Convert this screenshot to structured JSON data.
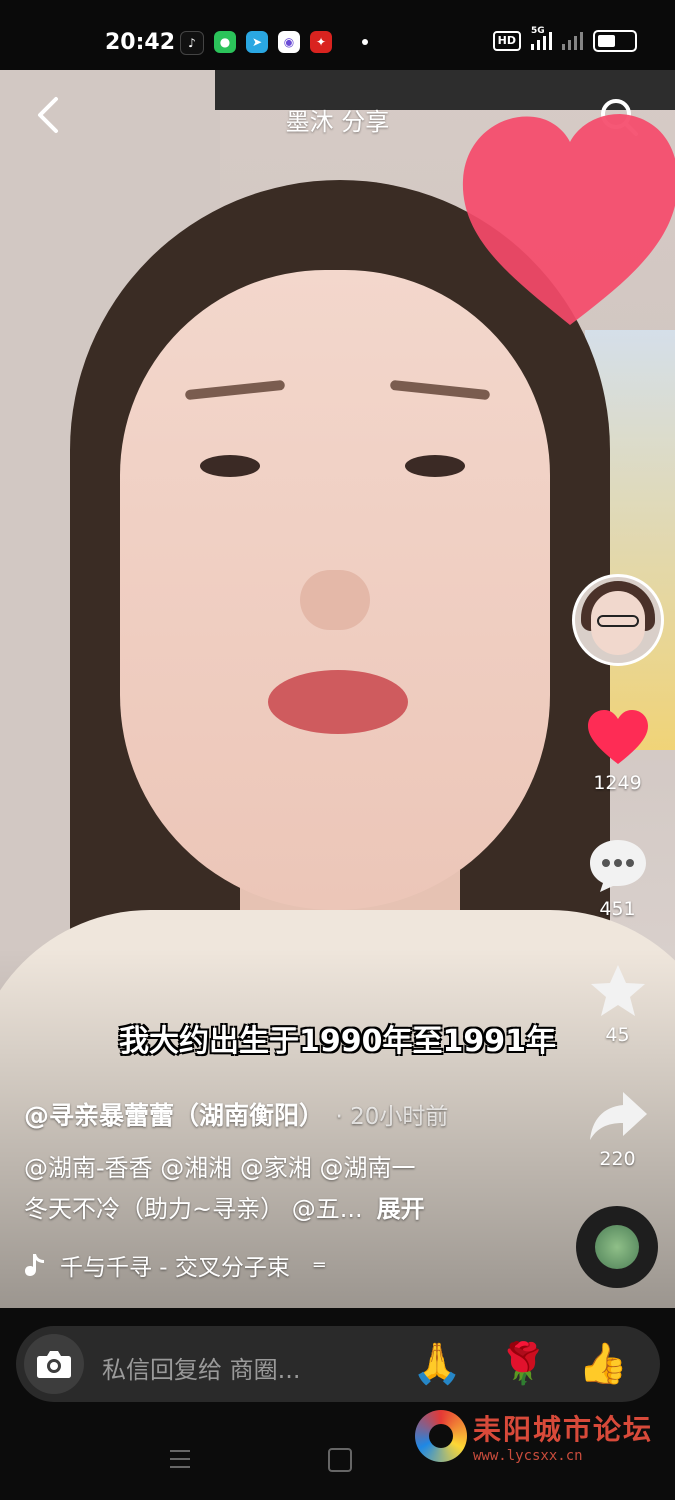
{
  "status_bar": {
    "time": "20:42",
    "network": "5G",
    "hd_badge": "HD",
    "battery_level": 0.55
  },
  "header": {
    "title": "墨沐 分享"
  },
  "video": {
    "subtitle": "我大约出生于1990年至1991年"
  },
  "actions": {
    "like_count": "1249",
    "comment_count": "451",
    "favorite_count": "45",
    "share_count": "220"
  },
  "post": {
    "author": "@寻亲暴蕾蕾（湖南衡阳）",
    "time_ago": "· 20小时前",
    "description_line1": "@湖南-香香 @湘湘 @家湘 @湖南一",
    "description_line2": "冬天不冷（助力~寻亲） @五...",
    "expand_label": "展开",
    "music": "千与千寻 - 交叉分子束"
  },
  "reply_bar": {
    "placeholder": "私信回复给 商圈...",
    "quick_emojis": [
      "🙏",
      "🌹",
      "👍"
    ]
  },
  "watermark": {
    "text": "耒阳城市论坛",
    "url": "www.lycsxx.cn"
  },
  "colors": {
    "like_red": "#fe2c55",
    "heart_pink": "#f54a6a",
    "watermark_red": "#d84a3a"
  }
}
